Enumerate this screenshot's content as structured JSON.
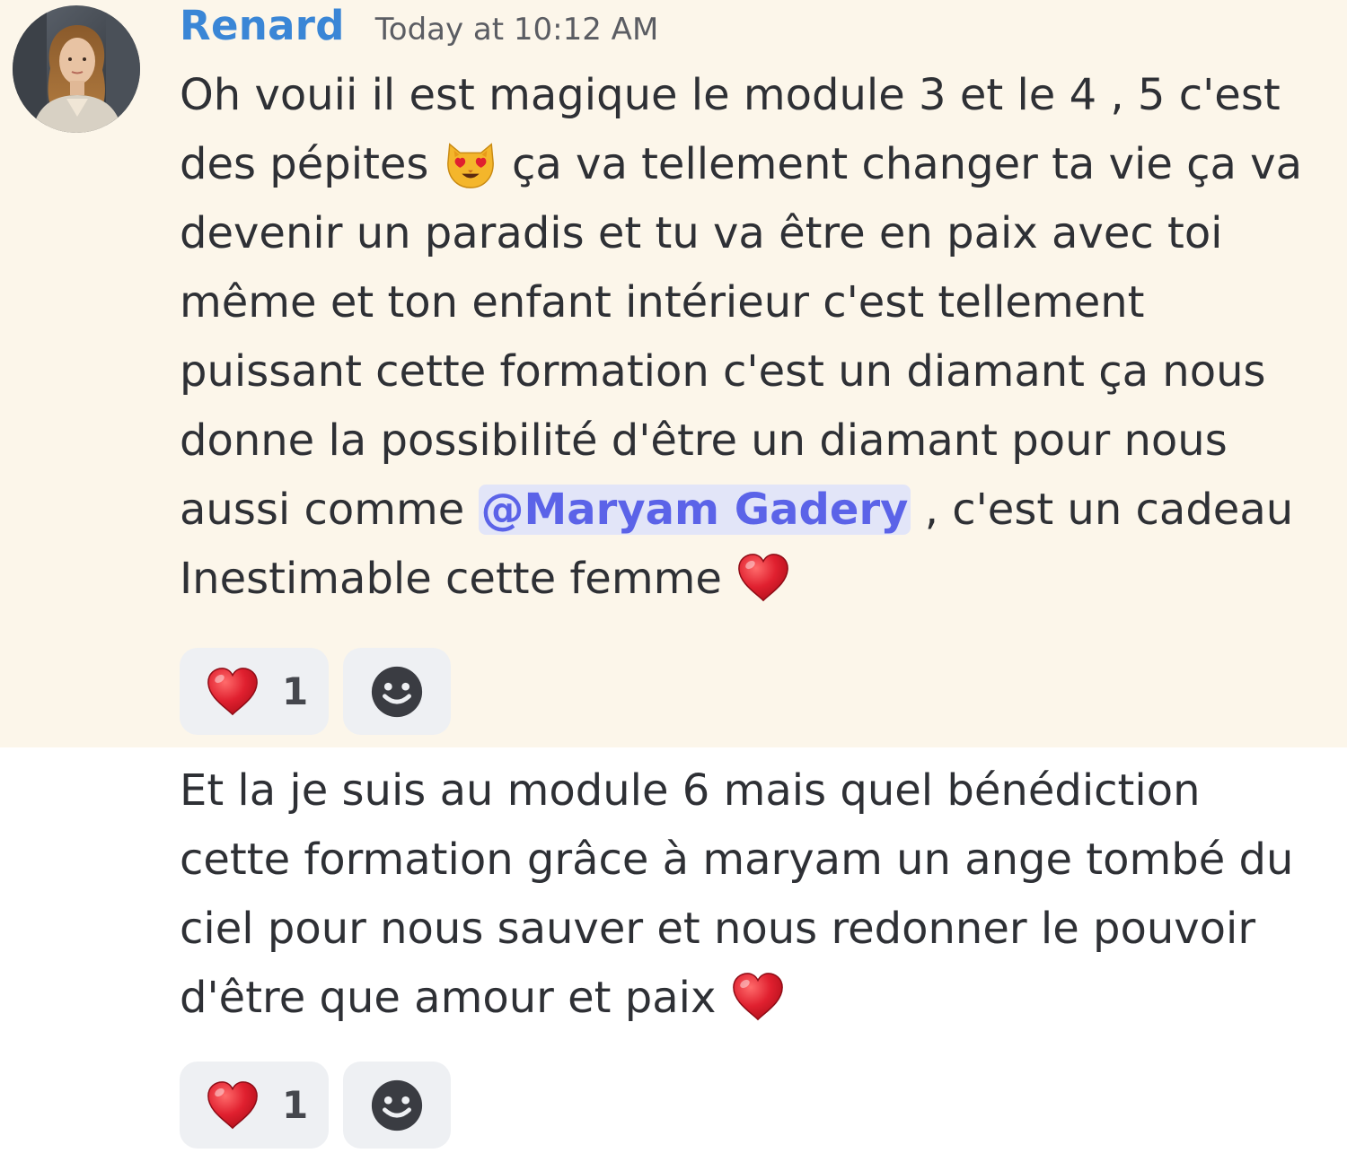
{
  "message_group": {
    "author": "Renard",
    "timestamp": "Today at 10:12 AM",
    "avatar_icon": "user-avatar-photo",
    "messages": [
      {
        "lines": [
          "Oh vouii il est magique le module 3 et le 4 , 5 c'est",
          "des pépites",
          "ça va tellement changer ta vie ça va",
          "devenir un paradis et tu va être en paix avec toi",
          "même et ton enfant intérieur c'est tellement",
          "puissant cette formation c'est un diamant ça nous",
          "donne la possibilité d'être un diamant pour nous",
          "aussi comme",
          "@Maryam Gadery",
          ", c'est un cadeau",
          "Inestimable cette femme"
        ],
        "reactions": [
          {
            "emoji": "heart-emoji",
            "count": "1"
          }
        ],
        "add_reaction_icon": "smiley-add-reaction-icon"
      },
      {
        "lines": [
          "Et la je suis au module 6 mais quel bénédiction",
          "cette formation grâce à maryam un ange tombé du",
          "ciel pour nous sauver et nous redonner le pouvoir",
          "d'être que amour et paix"
        ],
        "reactions": [
          {
            "emoji": "heart-emoji",
            "count": "1"
          }
        ],
        "add_reaction_icon": "smiley-add-reaction-icon"
      }
    ]
  },
  "colors": {
    "highlight_background": "#fcf6ea",
    "username": "#3a86d6",
    "mention_text": "#5b63e8",
    "mention_background": "#e2e5f8",
    "reaction_background": "#eef0f3",
    "heart": "#e0202f"
  }
}
